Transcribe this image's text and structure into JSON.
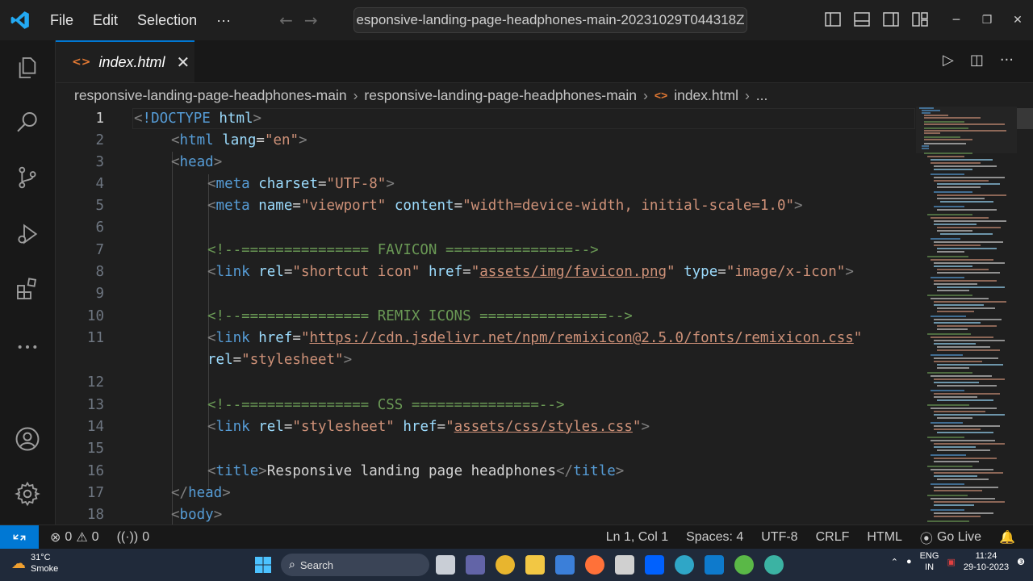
{
  "menu": {
    "file": "File",
    "edit": "Edit",
    "selection": "Selection",
    "more": "···"
  },
  "command_center": {
    "text": "esponsive-landing-page-headphones-main-20231029T044318Z"
  },
  "tab": {
    "title": "index.html",
    "icon": "<>",
    "close": "✕"
  },
  "breadcrumb": {
    "folder1": "responsive-landing-page-headphones-main",
    "folder2": "responsive-landing-page-headphones-main",
    "file": "index.html",
    "more": "..."
  },
  "editor": {
    "lines": [
      {
        "n": "1"
      },
      {
        "n": "2"
      },
      {
        "n": "3"
      },
      {
        "n": "4"
      },
      {
        "n": "5"
      },
      {
        "n": "6"
      },
      {
        "n": "7"
      },
      {
        "n": "8"
      },
      {
        "n": "9"
      },
      {
        "n": "10"
      },
      {
        "n": "11"
      },
      {
        "n": ""
      },
      {
        "n": "12"
      },
      {
        "n": "13"
      },
      {
        "n": "14"
      },
      {
        "n": "15"
      },
      {
        "n": "16"
      },
      {
        "n": "17"
      },
      {
        "n": "18"
      }
    ],
    "code": {
      "l1_doctype": "!DOCTYPE",
      "l1_html": " html",
      "l2_tag": "html",
      "l2_attr": " lang",
      "l2_val": "\"en\"",
      "l3_tag": "head",
      "l4_tag": "meta",
      "l4_attr": " charset",
      "l4_val": "\"UTF-8\"",
      "l5_tag": "meta",
      "l5_attr1": " name",
      "l5_val1": "\"viewport\"",
      "l5_attr2": " content",
      "l5_val2": "\"width=device-width, initial-scale=1.0\"",
      "l7_comment": "<!--=============== FAVICON ===============-->",
      "l8_tag": "link",
      "l8_attr1": " rel",
      "l8_val1": "\"shortcut icon\"",
      "l8_attr2": " href",
      "l8_q1": "\"",
      "l8_link": "assets/img/favicon.png",
      "l8_q2": "\"",
      "l8_attr3": " type",
      "l8_val3": "\"image/x-icon\"",
      "l10_comment": "<!--=============== REMIX ICONS ===============-->",
      "l11_tag": "link",
      "l11_attr1": " href",
      "l11_q1": "\"",
      "l11_link": "https://cdn.jsdelivr.net/npm/remixicon@2.5.0/fonts/remixicon.css",
      "l11_q2": "\"",
      "l11b_attr": "rel",
      "l11b_val": "\"stylesheet\"",
      "l13_comment": "<!--=============== CSS ===============-->",
      "l14_tag": "link",
      "l14_attr1": " rel",
      "l14_val1": "\"stylesheet\"",
      "l14_attr2": " href",
      "l14_q1": "\"",
      "l14_link": "assets/css/styles.css",
      "l14_q2": "\"",
      "l16_tag": "title",
      "l16_text": "Responsive landing page headphones",
      "l16_endtag": "title",
      "l17_endtag": "head",
      "l18_tag": "body"
    }
  },
  "status": {
    "errors": "0",
    "warnings": "0",
    "ports": "0",
    "position": "Ln 1, Col 1",
    "spaces": "Spaces: 4",
    "encoding": "UTF-8",
    "eol": "CRLF",
    "language": "HTML",
    "golive": "Go Live"
  },
  "taskbar": {
    "temp": "31°C",
    "weather": "Smoke",
    "search": "Search",
    "lang1": "ENG",
    "lang2": "IN",
    "time": "11:24",
    "date": "29-10-2023"
  },
  "colors": {
    "accent": "#0078d4",
    "tag": "#569cd6",
    "attr": "#9cdcfe",
    "string": "#ce9178",
    "comment": "#6a9955"
  }
}
